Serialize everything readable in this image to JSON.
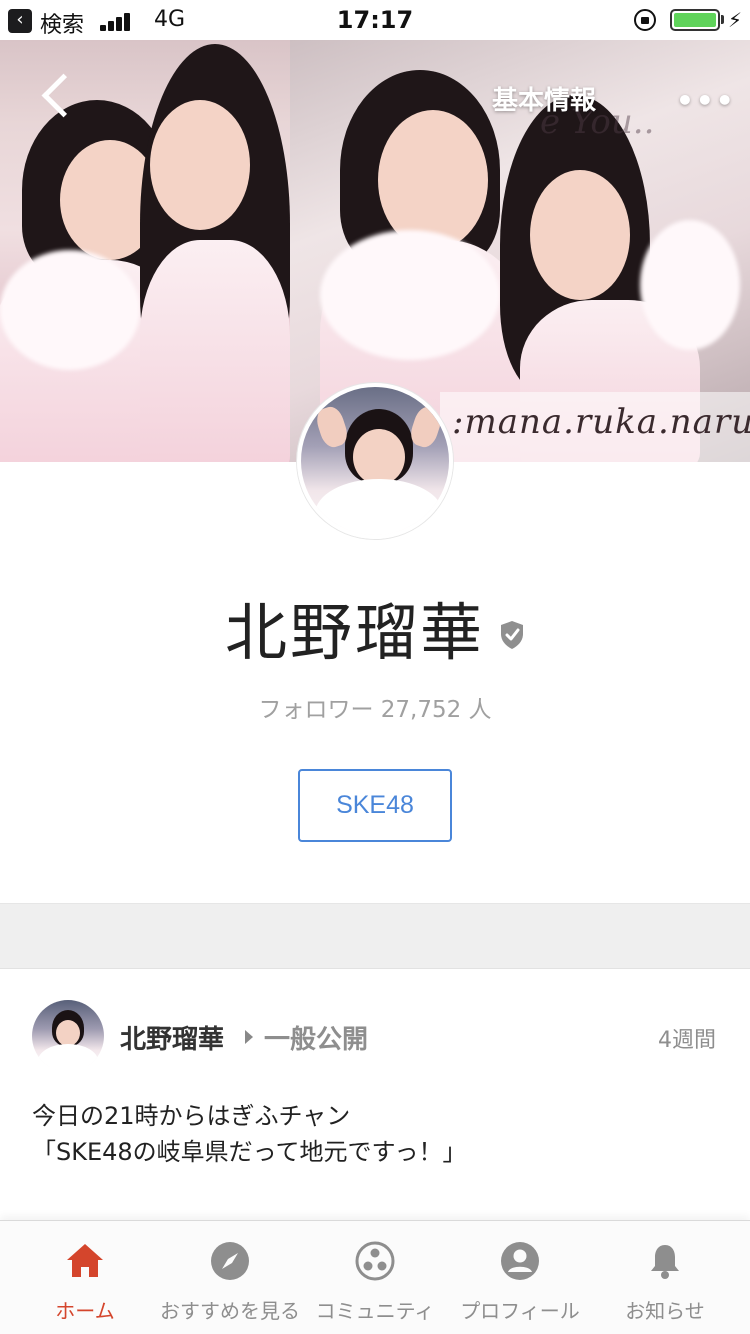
{
  "status_bar": {
    "back_label": "検索",
    "network": "4G",
    "time": "17:17"
  },
  "header": {
    "info_label": "基本情報",
    "more_label": "•••",
    "cover_caption": ":mana.ruka.naru",
    "cover_script": "e You.."
  },
  "profile": {
    "name": "北野瑠華",
    "followers": "フォロワー 27,752 人",
    "tag": "SKE48"
  },
  "post": {
    "author": "北野瑠華",
    "visibility": "一般公開",
    "time": "4週間",
    "body_line1": "今日の21時からはぎふチャン",
    "body_line2": "「SKE48の岐阜県だって地元ですっ！」"
  },
  "tabs": [
    {
      "label": "ホーム",
      "icon": "home-icon",
      "active": true
    },
    {
      "label": "おすすめを見る",
      "icon": "compass-icon",
      "active": false
    },
    {
      "label": "コミュニティ",
      "icon": "community-icon",
      "active": false
    },
    {
      "label": "プロフィール",
      "icon": "profile-icon",
      "active": false
    },
    {
      "label": "お知らせ",
      "icon": "bell-icon",
      "active": false
    }
  ],
  "colors": {
    "accent_active": "#d4452c",
    "tag_blue": "#4a86d9",
    "inactive": "#8e8e8e"
  }
}
